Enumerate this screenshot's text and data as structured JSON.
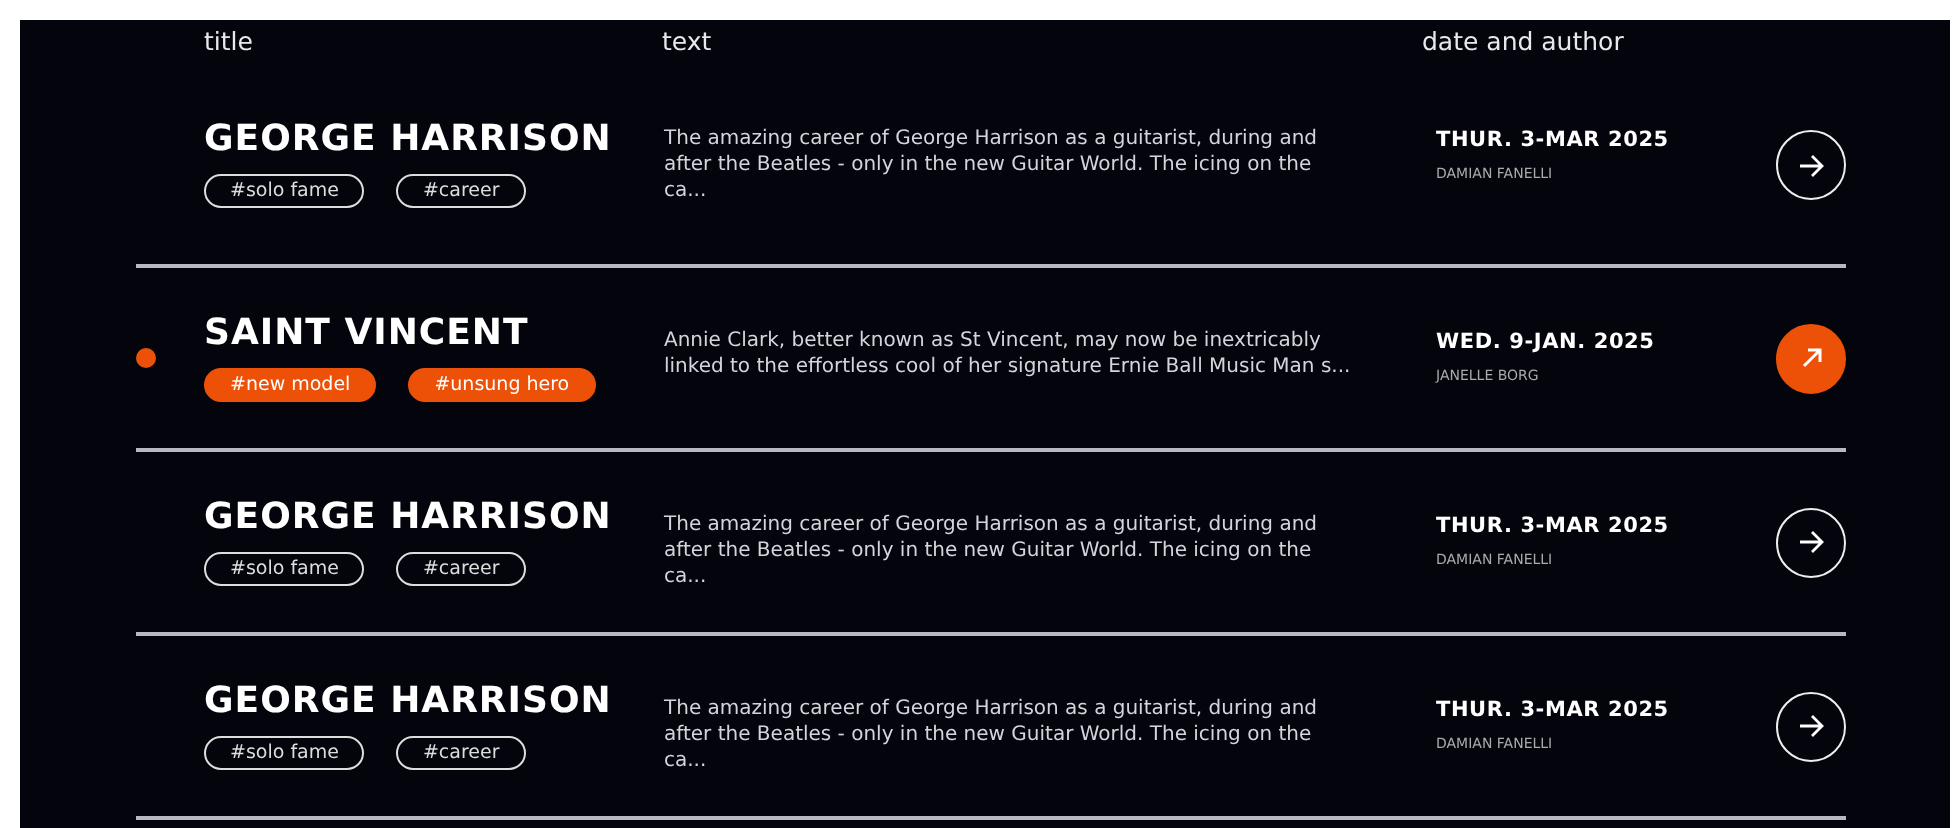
{
  "columns": [
    "title",
    "text",
    "date and author"
  ],
  "articles": [
    {
      "title": "GEORGE HARRISON",
      "tags": [
        "#solo fame",
        "#career"
      ],
      "text": "The amazing career of George Harrison as a guitarist, during and after the Beatles - only in the new Guitar World. The icing on the ca...",
      "date": "THUR. 3-MAR 2025",
      "author": "DAMIAN FANELLI",
      "selected": false
    },
    {
      "title": "SAINT VINCENT",
      "tags": [
        "#new model",
        "#unsung hero"
      ],
      "text": "Annie Clark, better known as St Vincent, may now be inextricably linked to the effortless cool of her signature Ernie Ball Music Man s...",
      "date": "WED. 9-JAN. 2025",
      "author": "JANELLE BORG",
      "selected": true
    },
    {
      "title": "GEORGE HARRISON",
      "tags": [
        "#solo fame",
        "#career"
      ],
      "text": "The amazing career of George Harrison as a guitarist, during and after the Beatles - only in the new Guitar World. The icing on the ca...",
      "date": "THUR. 3-MAR 2025",
      "author": "DAMIAN FANELLI",
      "selected": false
    },
    {
      "title": "GEORGE HARRISON",
      "tags": [
        "#solo fame",
        "#career"
      ],
      "text": "The amazing career of George Harrison as a guitarist, during and after the Beatles - only in the new Guitar World. The icing on the ca...",
      "date": "THUR. 3-MAR 2025",
      "author": "DAMIAN FANELLI",
      "selected": false
    }
  ]
}
